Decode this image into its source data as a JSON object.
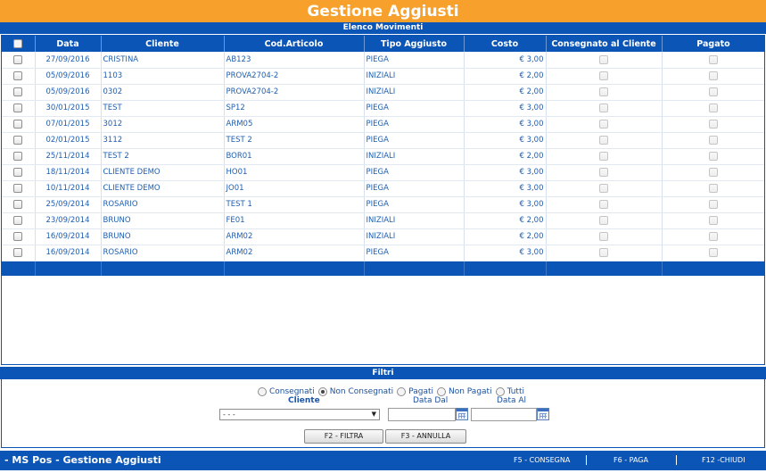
{
  "header": {
    "title": "Gestione Aggiusti",
    "subtitle": "Elenco Movimenti"
  },
  "table": {
    "columns": [
      "Data",
      "Cliente",
      "Cod.Articolo",
      "Tipo Aggiusto",
      "Costo",
      "Consegnato al Cliente",
      "Pagato"
    ],
    "rows": [
      {
        "data": "27/09/2016",
        "cliente": "CRISTINA",
        "articolo": "AB123",
        "tipo": "PIEGA",
        "costo": "€ 3,00"
      },
      {
        "data": "05/09/2016",
        "cliente": "1103",
        "articolo": "PROVA2704-2",
        "tipo": "INIZIALI",
        "costo": "€ 2,00"
      },
      {
        "data": "05/09/2016",
        "cliente": "0302",
        "articolo": "PROVA2704-2",
        "tipo": "INIZIALI",
        "costo": "€ 2,00"
      },
      {
        "data": "30/01/2015",
        "cliente": "TEST",
        "articolo": "SP12",
        "tipo": "PIEGA",
        "costo": "€ 3,00"
      },
      {
        "data": "07/01/2015",
        "cliente": "3012",
        "articolo": "ARM05",
        "tipo": "PIEGA",
        "costo": "€ 3,00"
      },
      {
        "data": "02/01/2015",
        "cliente": "3112",
        "articolo": "TEST 2",
        "tipo": "PIEGA",
        "costo": "€ 3,00"
      },
      {
        "data": "25/11/2014",
        "cliente": "TEST 2",
        "articolo": "BOR01",
        "tipo": "INIZIALI",
        "costo": "€ 2,00"
      },
      {
        "data": "18/11/2014",
        "cliente": "CLIENTE DEMO",
        "articolo": "HO01",
        "tipo": "PIEGA",
        "costo": "€ 3,00"
      },
      {
        "data": "10/11/2014",
        "cliente": "CLIENTE DEMO",
        "articolo": "JO01",
        "tipo": "PIEGA",
        "costo": "€ 3,00"
      },
      {
        "data": "25/09/2014",
        "cliente": "ROSARIO",
        "articolo": "TEST 1",
        "tipo": "PIEGA",
        "costo": "€ 3,00"
      },
      {
        "data": "23/09/2014",
        "cliente": "BRUNO",
        "articolo": "FE01",
        "tipo": "INIZIALI",
        "costo": "€ 2,00"
      },
      {
        "data": "16/09/2014",
        "cliente": "BRUNO",
        "articolo": "ARM02",
        "tipo": "INIZIALI",
        "costo": "€ 2,00"
      },
      {
        "data": "16/09/2014",
        "cliente": "ROSARIO",
        "articolo": "ARM02",
        "tipo": "PIEGA",
        "costo": "€ 3,00"
      }
    ]
  },
  "filters": {
    "title": "Filtri",
    "radios": [
      {
        "label": "Consegnati",
        "checked": false
      },
      {
        "label": "Non Consegnati",
        "checked": true
      },
      {
        "label": "Pagati",
        "checked": false
      },
      {
        "label": "Non Pagati",
        "checked": false
      },
      {
        "label": "Tutti",
        "checked": false
      }
    ],
    "cliente_label": "Cliente",
    "cliente_value": "- - -",
    "data_dal_label": "Data Dal",
    "data_al_label": "Data Al",
    "filtra_button": "F2 - FILTRA",
    "annulla_button": "F3 - ANNULLA"
  },
  "status_bar": {
    "title": "- MS Pos - Gestione Aggiusti",
    "consegna": "F5 - CONSEGNA",
    "paga": "F6 - PAGA",
    "chiudi": "F12 -CHIUDI"
  },
  "colors": {
    "accent_orange": "#f7a12c",
    "primary_blue": "#0b55b6",
    "text_blue": "#1a4f9c"
  }
}
